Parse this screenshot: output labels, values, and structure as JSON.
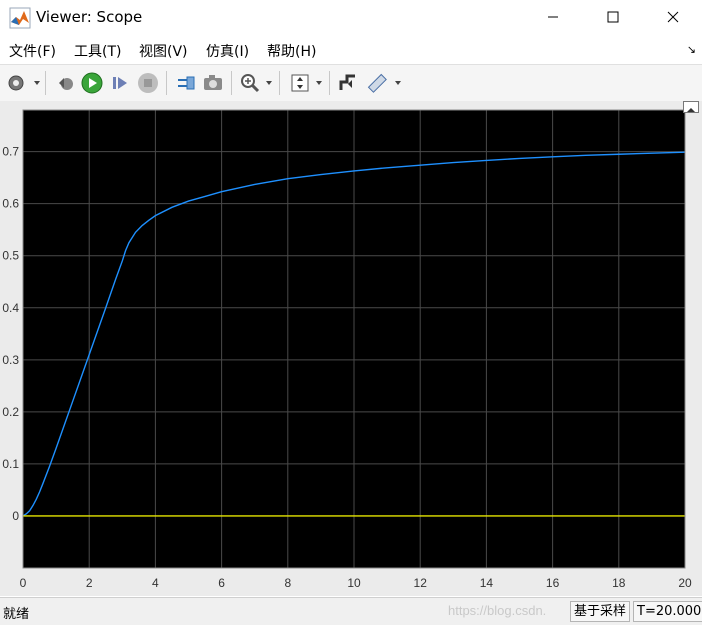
{
  "window": {
    "title": "Viewer: Scope"
  },
  "menu": {
    "items": [
      "文件(F)",
      "工具(T)",
      "视图(V)",
      "仿真(I)",
      "帮助(H)"
    ]
  },
  "toolbar": {
    "buttons": [
      "settings-icon",
      "step-back-icon",
      "run-icon",
      "step-forward-icon",
      "stop-icon",
      "highlight-icon",
      "snapshot-icon",
      "zoom-icon",
      "scale-axes-icon",
      "trigger-icon",
      "measure-icon"
    ]
  },
  "statusbar": {
    "left_text": "就绪",
    "watermark": "https://blog.csdn.",
    "sample_mode": "基于采样",
    "time": "T=20.000"
  },
  "chart_data": {
    "type": "line",
    "background": "#000000",
    "grid": true,
    "xlim": [
      0,
      20
    ],
    "ylim": [
      -0.1,
      0.78
    ],
    "x_ticks": [
      "0",
      "2",
      "4",
      "6",
      "8",
      "10",
      "12",
      "14",
      "16",
      "18",
      "20"
    ],
    "y_ticks": [
      "0",
      "0.1",
      "0.2",
      "0.3",
      "0.4",
      "0.5",
      "0.6",
      "0.7"
    ],
    "series": [
      {
        "color": "#1e90ff",
        "points": [
          [
            0,
            0
          ],
          [
            0.1,
            0.004
          ],
          [
            0.2,
            0.01
          ],
          [
            0.3,
            0.02
          ],
          [
            0.4,
            0.032
          ],
          [
            0.5,
            0.046
          ],
          [
            0.6,
            0.062
          ],
          [
            0.8,
            0.095
          ],
          [
            1.0,
            0.13
          ],
          [
            1.5,
            0.22
          ],
          [
            2.0,
            0.31
          ],
          [
            2.5,
            0.4
          ],
          [
            2.8,
            0.455
          ],
          [
            3.0,
            0.49
          ],
          [
            3.1,
            0.51
          ],
          [
            3.2,
            0.525
          ],
          [
            3.4,
            0.545
          ],
          [
            3.6,
            0.558
          ],
          [
            3.8,
            0.568
          ],
          [
            4.0,
            0.577
          ],
          [
            4.5,
            0.593
          ],
          [
            5.0,
            0.605
          ],
          [
            5.5,
            0.614
          ],
          [
            6.0,
            0.623
          ],
          [
            7.0,
            0.637
          ],
          [
            8.0,
            0.648
          ],
          [
            9.0,
            0.656
          ],
          [
            10.0,
            0.663
          ],
          [
            11.0,
            0.669
          ],
          [
            12.0,
            0.674
          ],
          [
            13.0,
            0.679
          ],
          [
            14.0,
            0.683
          ],
          [
            15.0,
            0.687
          ],
          [
            16.0,
            0.69
          ],
          [
            17.0,
            0.693
          ],
          [
            18.0,
            0.695
          ],
          [
            19.0,
            0.697
          ],
          [
            20.0,
            0.699
          ]
        ]
      },
      {
        "color": "#e6e600",
        "points": [
          [
            0,
            0
          ],
          [
            20,
            0
          ]
        ]
      }
    ]
  }
}
